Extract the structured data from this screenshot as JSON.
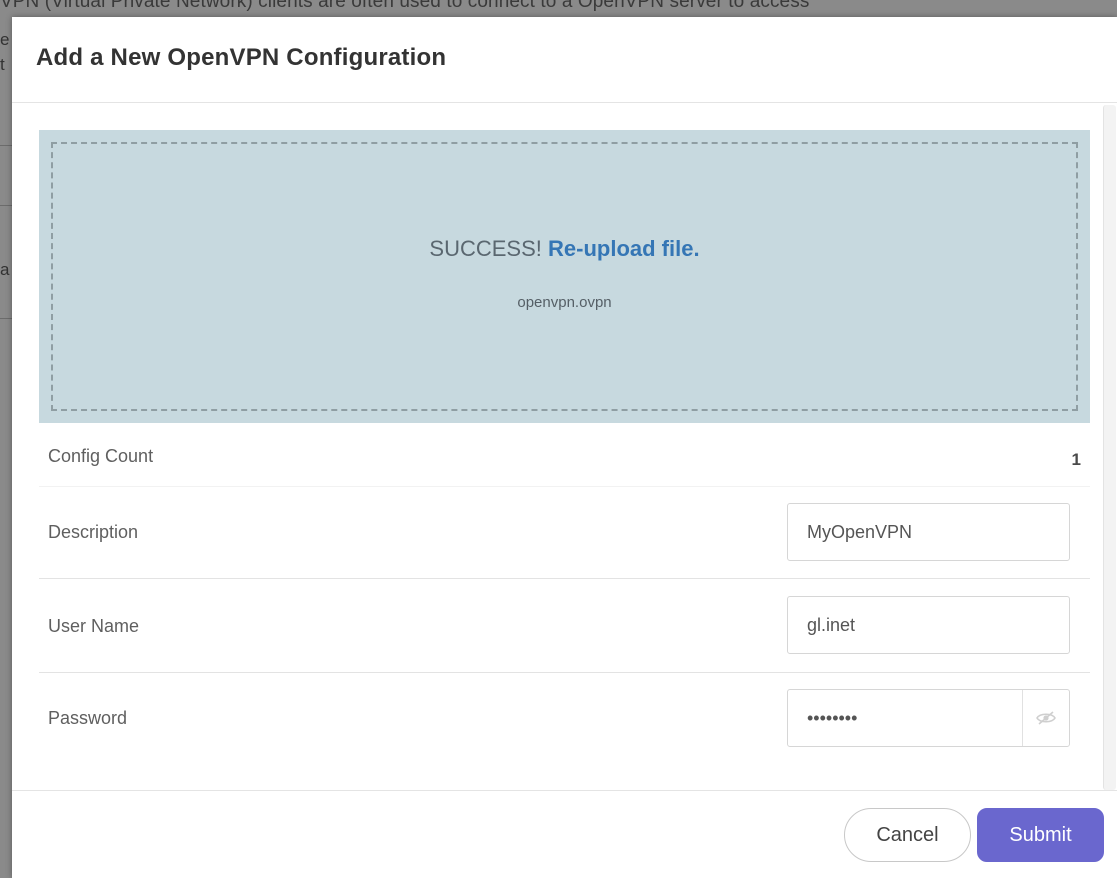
{
  "background": {
    "text": "VPN (Virtual Private Network) clients are often used to connect to a OpenVPN server to access"
  },
  "modal": {
    "title": "Add a New OpenVPN Configuration",
    "upload": {
      "success_text": "SUCCESS!",
      "reupload_link": "Re-upload file.",
      "file_name": "openvpn.ovpn"
    },
    "config_count": {
      "label": "Config Count",
      "value": "1"
    },
    "description": {
      "label": "Description",
      "value": "MyOpenVPN"
    },
    "username": {
      "label": "User Name",
      "value": "gl.inet"
    },
    "password": {
      "label": "Password",
      "value": "glinet12",
      "toggle_icon": "eye-slash-icon"
    },
    "footer": {
      "cancel_label": "Cancel",
      "submit_label": "Submit"
    }
  },
  "colors": {
    "upload_bg": "#c7d9df",
    "link": "#3576b5",
    "submit": "#6a67ce"
  }
}
